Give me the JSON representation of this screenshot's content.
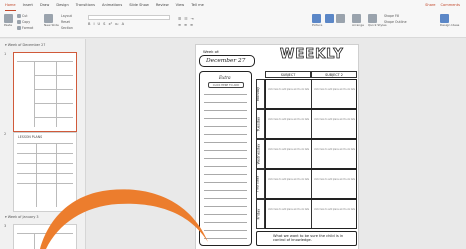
{
  "menu": {
    "tabs": [
      "Home",
      "Insert",
      "Draw",
      "Design",
      "Transitions",
      "Animations",
      "Slide Show",
      "Review",
      "View",
      "Tell me"
    ],
    "active_index": 0,
    "share_label": "Share",
    "comments_label": "Comments"
  },
  "ribbon": {
    "cut": "Cut",
    "copy": "Copy",
    "format": "Format",
    "paste": "Paste",
    "new_slide": "New Slide",
    "layout": "Layout",
    "reset": "Reset",
    "section": "Section",
    "convert_smartart": "Convert to SmartArt",
    "picture": "Picture",
    "arrange": "Arrange",
    "quick_styles": "Quick Styles",
    "shape_fill": "Shape Fill",
    "shape_outline": "Shape Outline",
    "design_ideas": "Design Ideas"
  },
  "slide_panel": {
    "section1": "Week of December 27",
    "section2": "Week of January 3",
    "thumbs": [
      {
        "number": "1"
      },
      {
        "number": "2",
        "caption": "LESSON PLANS"
      },
      {
        "number": "3"
      }
    ]
  },
  "slide": {
    "date_label": "Week of:",
    "date_value": "December 27",
    "title": "WEEKLY",
    "extras_title": "Extra",
    "extras_item": "CLICK HERE TO ADD",
    "subjects": [
      "SUBJECT",
      "SUBJECT 2"
    ],
    "days": [
      "Monday",
      "Tuesday",
      "Wednesday",
      "Thursday",
      "Friday"
    ],
    "cell_text": "click here to add plans and to-do lists",
    "footer": "What we want to be sure the child is in control of knowledge."
  },
  "colors": {
    "accent": "#c2472a",
    "swoosh": "#ec7d2d",
    "selected_thumb": "#d05a3a"
  }
}
